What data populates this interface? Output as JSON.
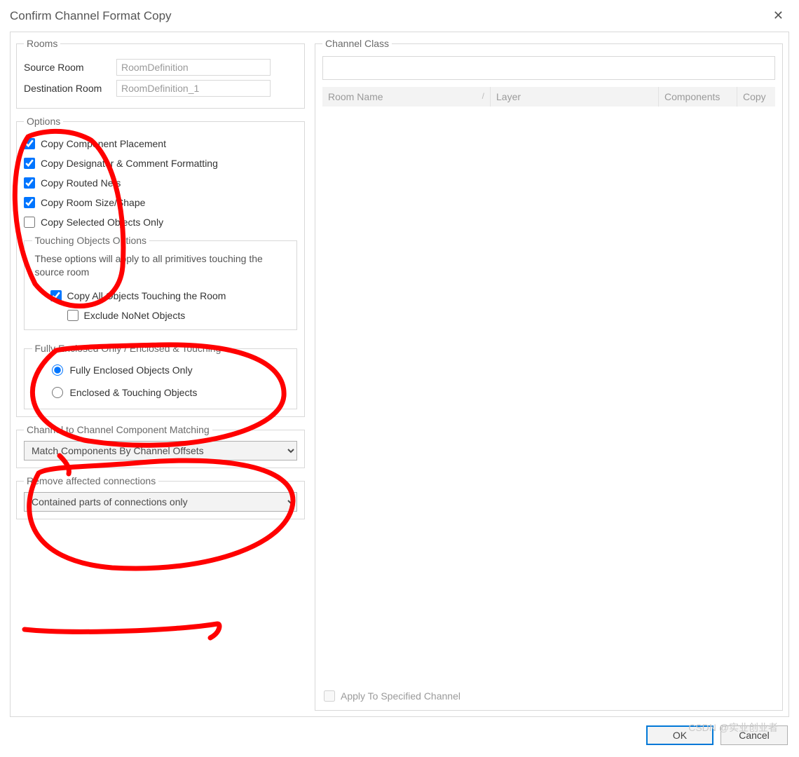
{
  "title": "Confirm Channel Format Copy",
  "rooms": {
    "legend": "Rooms",
    "source_label": "Source Room",
    "source_value": "RoomDefinition",
    "dest_label": "Destination Room",
    "dest_value": "RoomDefinition_1"
  },
  "options": {
    "legend": "Options",
    "copy_component_placement": "Copy Component Placement",
    "copy_designator": "Copy Designator & Comment Formatting",
    "copy_routed_nets": "Copy Routed Nets",
    "copy_room_size": "Copy Room Size/Shape",
    "copy_selected_only": "Copy Selected Objects Only",
    "touching": {
      "legend": "Touching Objects Options",
      "desc": "These options will apply to all primitives touching the source room",
      "copy_all_touching": "Copy All Objects Touching the Room",
      "exclude_nonet": "Exclude NoNet Objects"
    },
    "enclosed": {
      "legend": "Fully Enclosed Only / Enclosed & Touching",
      "fully": "Fully Enclosed Objects Only",
      "touching": "Enclosed & Touching Objects"
    }
  },
  "matching": {
    "legend": "Channel to Channel Component Matching",
    "value": "Match Components By Channel Offsets"
  },
  "remove": {
    "legend": "Remove affected connections",
    "value": "Contained parts of connections only"
  },
  "channel_class": {
    "legend": "Channel Class",
    "col_room": "Room Name",
    "col_layer": "Layer",
    "col_components": "Components",
    "col_copy": "Copy",
    "apply_label": "Apply To Specified Channel"
  },
  "buttons": {
    "ok": "OK",
    "cancel": "Cancel"
  },
  "watermark": "CSDN @实业创业者"
}
